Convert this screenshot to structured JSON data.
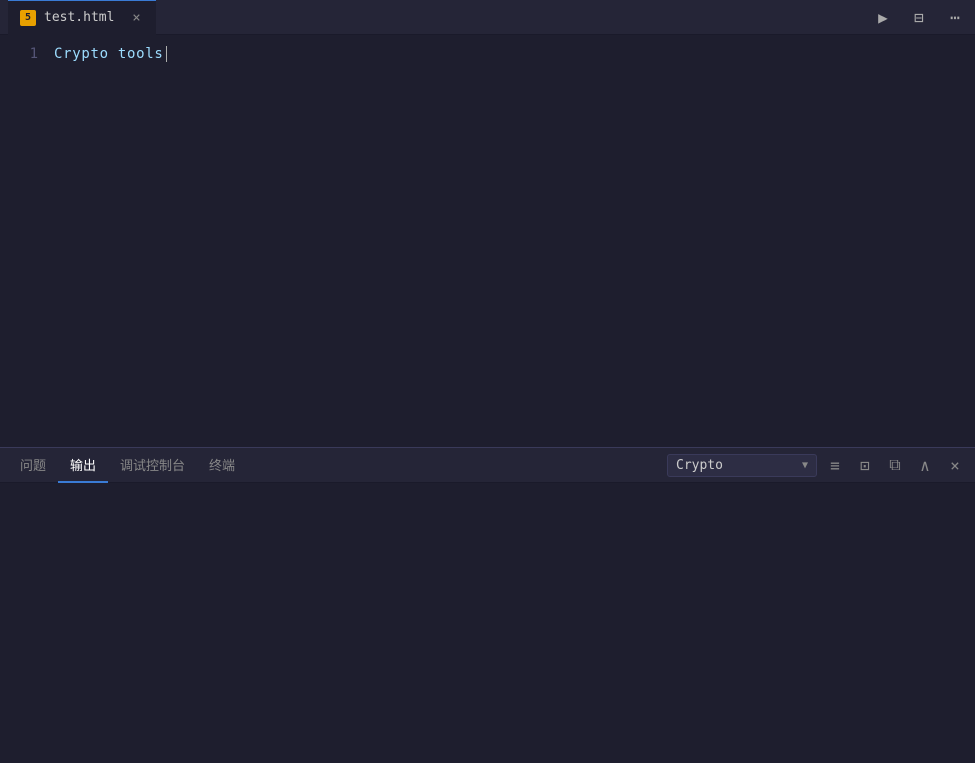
{
  "titleBar": {
    "tab": {
      "filename": "test.html",
      "closeLabel": "×"
    },
    "actions": {
      "run": "▶",
      "splitEditor": "⊟",
      "moreActions": "⋯"
    }
  },
  "editor": {
    "lineNumbers": [
      "1"
    ],
    "lines": [
      {
        "content": "Crypto tools"
      }
    ],
    "cursorPosition": {
      "line": 1,
      "col": 14
    }
  },
  "panel": {
    "tabs": [
      {
        "label": "问题",
        "active": false
      },
      {
        "label": "输出",
        "active": true
      },
      {
        "label": "调试控制台",
        "active": false
      },
      {
        "label": "终端",
        "active": false
      }
    ],
    "dropdown": {
      "selected": "Crypto",
      "arrow": "▼"
    },
    "actions": {
      "clearOutput": "≡",
      "copyOutput": "⊡",
      "newTerminal": "⧉",
      "collapsePanel": "∧",
      "closePanel": "×"
    }
  }
}
